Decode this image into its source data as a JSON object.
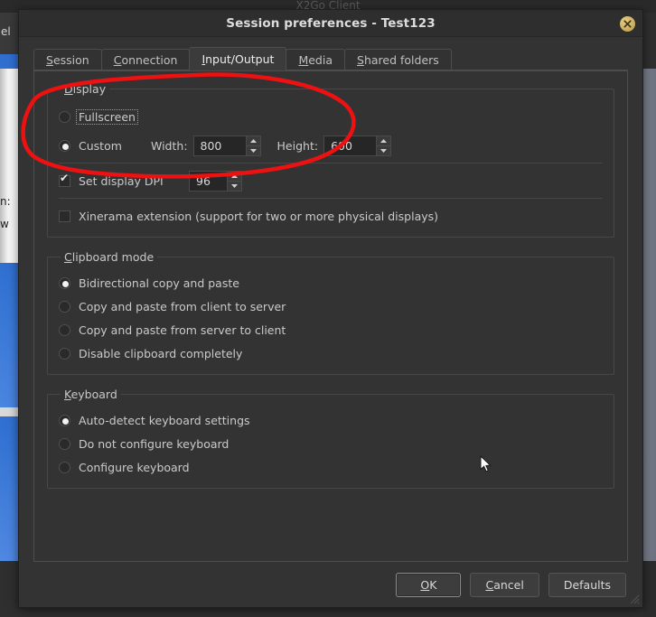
{
  "background": {
    "app_title": "X2Go Client",
    "toolbar_fragment": "el",
    "text_fragments": [
      "n:",
      "w"
    ]
  },
  "dialog": {
    "title": "Session preferences - Test123",
    "close_icon": "close-icon"
  },
  "tabs": [
    {
      "label": "Session",
      "accel": "S",
      "active": false
    },
    {
      "label": "Connection",
      "accel": "C",
      "active": false
    },
    {
      "label": "Input/Output",
      "accel": "I",
      "active": true
    },
    {
      "label": "Media",
      "accel": "M",
      "active": false
    },
    {
      "label": "Shared folders",
      "accel": "S",
      "active": false
    }
  ],
  "display": {
    "legend": "Display",
    "legend_accel": "D",
    "fullscreen": {
      "label": "Fullscreen",
      "selected": false,
      "focused": true
    },
    "custom": {
      "label": "Custom",
      "selected": true
    },
    "width": {
      "label": "Width:",
      "value": "800"
    },
    "height": {
      "label": "Height:",
      "value": "600"
    },
    "dpi": {
      "label": "Set display DPI",
      "checked": true,
      "value": "96"
    },
    "xinerama": {
      "label": "Xinerama extension (support for two or more physical displays)",
      "checked": false
    }
  },
  "clipboard": {
    "legend": "Clipboard mode",
    "legend_accel": "C",
    "options": [
      {
        "label": "Bidirectional copy and paste",
        "selected": true
      },
      {
        "label": "Copy and paste from client to server",
        "selected": false
      },
      {
        "label": "Copy and paste from server to client",
        "selected": false
      },
      {
        "label": "Disable clipboard completely",
        "selected": false
      }
    ]
  },
  "keyboard": {
    "legend": "Keyboard",
    "legend_accel": "K",
    "options": [
      {
        "label": "Auto-detect keyboard settings",
        "selected": true
      },
      {
        "label": "Do not configure keyboard",
        "selected": false
      },
      {
        "label": "Configure keyboard",
        "selected": false
      }
    ]
  },
  "buttons": {
    "ok": {
      "label": "OK",
      "accel": "O",
      "default": true
    },
    "cancel": {
      "label": "Cancel",
      "accel": "C",
      "default": false
    },
    "defaults": {
      "label": "Defaults",
      "accel": "",
      "default": false
    }
  },
  "annotation": {
    "shape": "ellipse",
    "color": "#ee1111"
  },
  "colors": {
    "window_bg": "#333333",
    "titlebar_bg": "#2e2e2e",
    "text": "#c9cacc",
    "accent_close": "#cdb261",
    "annotation_red": "#ee1111",
    "desktop_blue": "#2f6fd0"
  }
}
